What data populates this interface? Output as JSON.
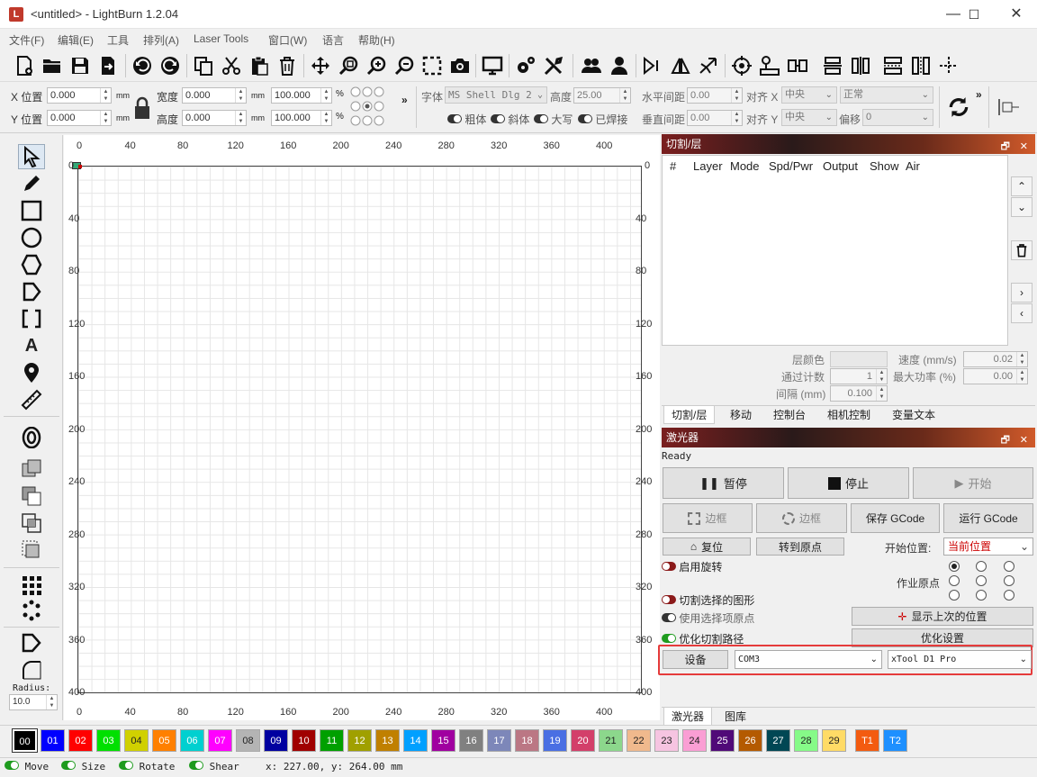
{
  "window": {
    "title": "<untitled> - LightBurn 1.2.04",
    "min": "—",
    "max": "☐",
    "close": "✕"
  },
  "menu": [
    "文件(F)",
    "编辑(E)",
    "工具",
    "排列(A)",
    "Laser Tools",
    "窗口(W)",
    "语言",
    "帮助(H)"
  ],
  "props": {
    "x_label": "X 位置",
    "y_label": "Y 位置",
    "x_val": "0.000",
    "y_val": "0.000",
    "unit_mm": "mm",
    "w_label": "宽度",
    "h_label": "高度",
    "w_val": "0.000",
    "h_val": "0.000",
    "pct_w": "100.000",
    "pct_h": "100.000",
    "pct": "%",
    "font_label": "字体",
    "font_val": "MS Shell Dlg 2",
    "height_label": "高度",
    "height_val": "25.00",
    "hspace_label": "水平间距",
    "hspace_val": "0.00",
    "vspace_label": "垂直间距",
    "vspace_val": "0.00",
    "align_x_label": "对齐 X",
    "align_x_val": "中央",
    "align_y_label": "对齐 Y",
    "align_y_val": "中央",
    "normal_val": "正常",
    "offset_label": "偏移",
    "offset_val": "0",
    "bold": "粗体",
    "italic": "斜体",
    "upper": "大写",
    "welded": "已焊接"
  },
  "left_tools": {
    "radius_label": "Radius:",
    "radius_val": "10.0"
  },
  "canvas": {
    "top_ticks": [
      "0",
      "40",
      "80",
      "120",
      "160",
      "200",
      "240",
      "280",
      "320",
      "360",
      "400"
    ],
    "side_ticks": [
      "0",
      "40",
      "80",
      "120",
      "160",
      "200",
      "240",
      "280",
      "320",
      "360",
      "400"
    ],
    "right_ticks": [
      "0",
      "40",
      "80",
      "120",
      "160",
      "200",
      "240",
      "280",
      "320",
      "360",
      "400"
    ]
  },
  "cuts_panel": {
    "title": "切割/层",
    "columns": [
      "#",
      "Layer",
      "Mode",
      "Spd/Pwr",
      "Output",
      "Show",
      "Air"
    ],
    "layer_color_label": "层颜色",
    "speed_label": "速度 (mm/s)",
    "speed_val": "0.02",
    "passes_label": "通过计数",
    "passes_val": "1",
    "maxpower_label": "最大功率 (%)",
    "maxpower_val": "0.00",
    "interval_label": "间隔 (mm)",
    "interval_val": "0.100",
    "tabs": [
      "切割/层",
      "移动",
      "控制台",
      "相机控制",
      "变量文本"
    ]
  },
  "laser_panel": {
    "title": "激光器",
    "status": "Ready",
    "pause": "暂停",
    "stop": "停止",
    "start": "开始",
    "frame1": "边框",
    "frame2": "边框",
    "save_gcode": "保存 GCode",
    "run_gcode": "运行 GCode",
    "home": "复位",
    "goto_origin": "转到原点",
    "start_from_label": "开始位置:",
    "start_from_val": "当前位置",
    "rotary": "启用旋转",
    "job_origin_label": "作业原点",
    "cut_selected": "切割选择的图形",
    "use_sel_origin": "使用选择项原点",
    "show_last": "显示上次的位置",
    "optimize": "优化切割路径",
    "optimize_settings": "优化设置",
    "devices": "设备",
    "port": "COM3",
    "device": "xTool D1 Pro",
    "tabs": [
      "激光器",
      "图库"
    ]
  },
  "palette": [
    {
      "label": "00",
      "color": "#000000"
    },
    {
      "label": "01",
      "color": "#0000ff"
    },
    {
      "label": "02",
      "color": "#ff0000"
    },
    {
      "label": "03",
      "color": "#00e000"
    },
    {
      "label": "04",
      "color": "#d0d000"
    },
    {
      "label": "05",
      "color": "#ff8000"
    },
    {
      "label": "06",
      "color": "#00d0d0"
    },
    {
      "label": "07",
      "color": "#ff00ff"
    },
    {
      "label": "08",
      "color": "#b4b4b4"
    },
    {
      "label": "09",
      "color": "#0000a0"
    },
    {
      "label": "10",
      "color": "#a00000"
    },
    {
      "label": "11",
      "color": "#00a000"
    },
    {
      "label": "12",
      "color": "#a0a000"
    },
    {
      "label": "13",
      "color": "#c08000"
    },
    {
      "label": "14",
      "color": "#00a0ff"
    },
    {
      "label": "15",
      "color": "#a000a0"
    },
    {
      "label": "16",
      "color": "#808080"
    },
    {
      "label": "17",
      "color": "#7d87b9"
    },
    {
      "label": "18",
      "color": "#bb7784"
    },
    {
      "label": "19",
      "color": "#4a6fe3"
    },
    {
      "label": "20",
      "color": "#d33f6a"
    },
    {
      "label": "21",
      "color": "#8cd78c"
    },
    {
      "label": "22",
      "color": "#f0b98d"
    },
    {
      "label": "23",
      "color": "#f6c4e1"
    },
    {
      "label": "24",
      "color": "#fa9ed4"
    },
    {
      "label": "25",
      "color": "#500a78"
    },
    {
      "label": "26",
      "color": "#b45a00"
    },
    {
      "label": "27",
      "color": "#004754"
    },
    {
      "label": "28",
      "color": "#86fa88"
    },
    {
      "label": "29",
      "color": "#ffdb66"
    },
    {
      "label": "T1",
      "color": "#f35b10"
    },
    {
      "label": "T2",
      "color": "#1e90ff"
    }
  ],
  "status": {
    "move": "Move",
    "size": "Size",
    "rotate": "Rotate",
    "shear": "Shear",
    "coords": "x: 227.00, y: 264.00 mm"
  }
}
